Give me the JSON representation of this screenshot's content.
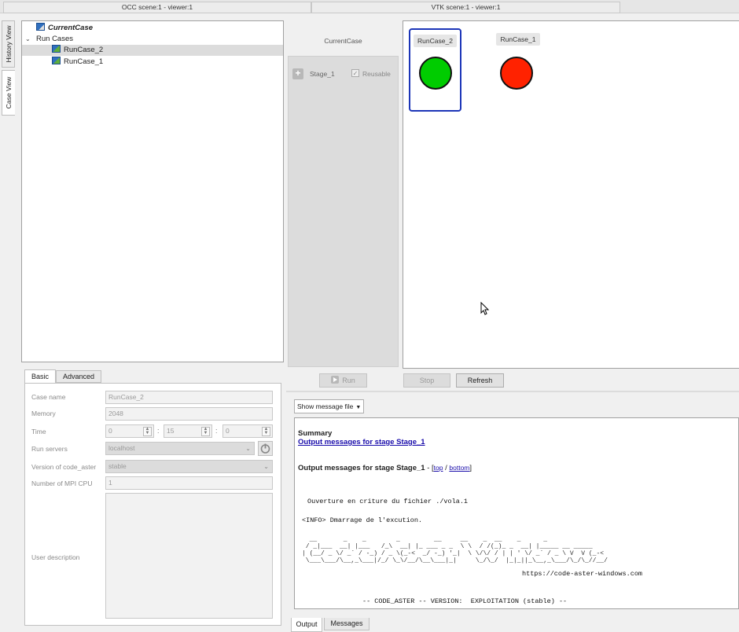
{
  "scene_tabs": {
    "occ": "OCC scene:1 - viewer:1",
    "vtk": "VTK scene:1 - viewer:1"
  },
  "side_tabs": {
    "history": "History View",
    "case": "Case View"
  },
  "tree": {
    "current_case": "CurrentCase",
    "run_cases": "Run Cases",
    "items": [
      "RunCase_2",
      "RunCase_1"
    ]
  },
  "stage_panel": {
    "header": "CurrentCase",
    "stage": "Stage_1",
    "reusable": "Reusable"
  },
  "cases_view": {
    "cards": [
      {
        "label": "RunCase_2",
        "color": "#00cc00"
      },
      {
        "label": "RunCase_1",
        "color": "#ff2200"
      }
    ]
  },
  "params": {
    "tabs": [
      "Basic",
      "Advanced"
    ],
    "case_name": {
      "label": "Case name",
      "value": "RunCase_2"
    },
    "memory": {
      "label": "Memory",
      "value": "2048"
    },
    "time": {
      "label": "Time",
      "h": "0",
      "m": "15",
      "s": "0",
      "sep": ":"
    },
    "run_servers": {
      "label": "Run servers",
      "value": "localhost"
    },
    "version": {
      "label": "Version of code_aster",
      "value": "stable"
    },
    "mpi": {
      "label": "Number of MPI CPU",
      "value": "1"
    },
    "desc": {
      "label": "User description"
    }
  },
  "buttons": {
    "run": "Run",
    "stop": "Stop",
    "refresh": "Refresh"
  },
  "output": {
    "show_file": "Show message file",
    "summary": "Summary",
    "link_stage": "Output messages for stage Stage_1",
    "heading": "Output messages for stage Stage_1",
    "heading_sep": " - [",
    "top": "top",
    "slash": " / ",
    "bottom": "bottom",
    "close": "]",
    "line1": "Ouverture en criture du fichier ./vola.1",
    "line2": "<INFO> Dmarrage de l'excution.",
    "ascii1": "  __       _    _        _         __     __    _  __    _      _         ",
    "ascii2": " / _|___  __| |___   /_\\  __| |_ ___ _ _  \\ \\  / /(_)_ _  __| |_____ __ _____ ",
    "ascii3": "| (__/ _ \\/ _` / -_) / _ \\(_-<  _/ -_) '_|  \\ \\/\\/ / | | ' \\/ _` / _ \\ V  V (_-<",
    "ascii4": " \\___\\___/\\__,_\\___|/_/ \\_\\/__/\\__\\___|_|     \\_/\\_/  |_|_||_\\__,_\\___/\\_/\\_//__/",
    "url": "https://code-aster-windows.com",
    "version_line": "-- CODE_ASTER -- VERSION:  EXPLOITATION (stable) --",
    "tabs": [
      "Output",
      "Messages"
    ]
  }
}
